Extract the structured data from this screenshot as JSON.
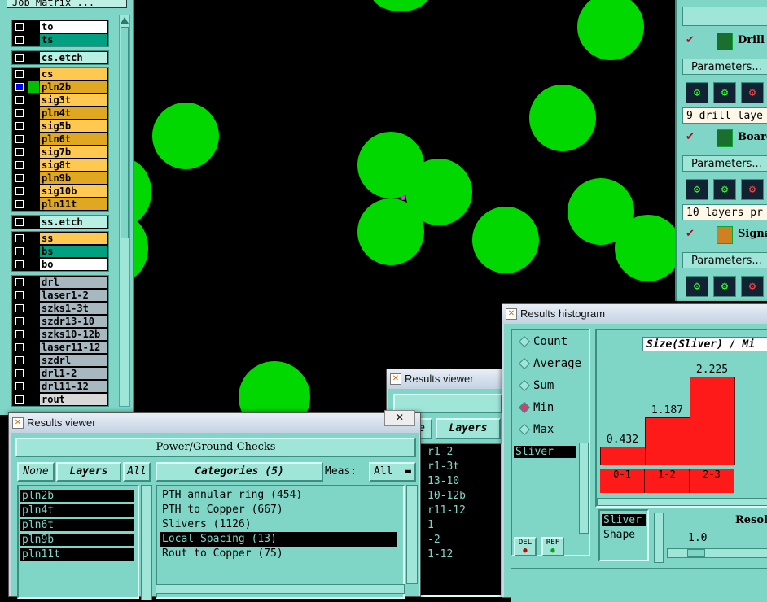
{
  "matrix": {
    "title": "Job Matrix ...",
    "groups": [
      {
        "rows": [
          {
            "name": "to",
            "bg": "#ffffff"
          },
          {
            "name": "ts",
            "bg": "#00a080"
          }
        ]
      },
      {
        "rows": [
          {
            "name": "cs.etch",
            "bg": "#b8f0e4"
          }
        ]
      },
      {
        "rows": [
          {
            "name": "cs",
            "bg": "#ffc850"
          },
          {
            "name": "pln2b",
            "bg": "#e0a820",
            "active": true
          },
          {
            "name": "sig3t",
            "bg": "#ffc850"
          },
          {
            "name": "pln4t",
            "bg": "#e0a820"
          },
          {
            "name": "sig5b",
            "bg": "#ffc850"
          },
          {
            "name": "pln6t",
            "bg": "#e0a820"
          },
          {
            "name": "sig7b",
            "bg": "#ffc850"
          },
          {
            "name": "sig8t",
            "bg": "#ffc850"
          },
          {
            "name": "pln9b",
            "bg": "#e0a820"
          },
          {
            "name": "sig10b",
            "bg": "#ffc850"
          },
          {
            "name": "pln11t",
            "bg": "#e0a820"
          }
        ]
      },
      {
        "rows": [
          {
            "name": "ss.etch",
            "bg": "#b8f0e4"
          }
        ]
      },
      {
        "rows": [
          {
            "name": "ss",
            "bg": "#ffc850"
          },
          {
            "name": "bs",
            "bg": "#00a080"
          },
          {
            "name": "bo",
            "bg": "#ffffff"
          }
        ]
      },
      {
        "rows": [
          {
            "name": "drl",
            "bg": "#a8b8c0"
          },
          {
            "name": "laser1-2",
            "bg": "#a8b8c0"
          },
          {
            "name": "szks1-3t",
            "bg": "#a8b8c0"
          },
          {
            "name": "szdr13-10",
            "bg": "#a8b8c0"
          },
          {
            "name": "szks10-12b",
            "bg": "#a8b8c0"
          },
          {
            "name": "laser11-12",
            "bg": "#a8b8c0"
          },
          {
            "name": "szdrl",
            "bg": "#a8b8c0"
          },
          {
            "name": "drl1-2",
            "bg": "#a8b8c0"
          },
          {
            "name": "drl11-12",
            "bg": "#a8b8c0"
          },
          {
            "name": "rout",
            "bg": "#d8d8d8"
          }
        ]
      }
    ]
  },
  "right_panel": {
    "actions": [
      {
        "label": "Drill C",
        "params": "Parameters...",
        "status": "9 drill laye"
      },
      {
        "label": "Board-",
        "params": "Parameters...",
        "status": "10 layers pr"
      },
      {
        "label": "Signal",
        "params": "Parameters..."
      }
    ]
  },
  "results_viewer": {
    "title": "Results viewer",
    "header": "Power/Ground Checks",
    "none_label": "None",
    "layers_label": "Layers",
    "all_label": "All",
    "categories_label": "Categories (5)",
    "meas_label": "Meas:",
    "meas_value": "All",
    "layers": [
      "pln2b",
      "pln4t",
      "pln6t",
      "pln9b",
      "pln11t"
    ],
    "categories": [
      {
        "text": "PTH annular ring (454)"
      },
      {
        "text": "PTH to Copper (667)"
      },
      {
        "text": "Slivers (1126)"
      },
      {
        "text": "Local Spacing (13)",
        "selected": true
      },
      {
        "text": "Rout to Copper (75)"
      }
    ]
  },
  "results_viewer2": {
    "title": "Results viewer",
    "tab_e": "e",
    "layers_label": "Layers",
    "items": [
      "r1-2",
      "r1-3t",
      "13-10",
      "10-12b",
      "r11-12",
      "1",
      "-2",
      "1-12"
    ]
  },
  "histogram": {
    "title": "Results histogram",
    "options": [
      {
        "label": "Count",
        "on": false
      },
      {
        "label": "Average",
        "on": false
      },
      {
        "label": "Sum",
        "on": false
      },
      {
        "label": "Min",
        "on": true
      },
      {
        "label": "Max",
        "on": false
      }
    ],
    "list_item": "Sliver",
    "del_label": "DEL",
    "ref_label": "REF",
    "chart_title": "Size(Sliver) / Mi",
    "shape_box": "Sliver",
    "shape_label": "Shape",
    "resol_label": "Resol",
    "resol_value": "1.0"
  },
  "chart_data": {
    "type": "bar",
    "title": "Size(Sliver) / Mi",
    "categories": [
      "0-1",
      "1-2",
      "2-3"
    ],
    "values": [
      0.432,
      1.187,
      2.225
    ],
    "ylim": [
      0,
      2.5
    ],
    "xlabel": "",
    "ylabel": "",
    "bar_color": "#ff1a1a"
  }
}
